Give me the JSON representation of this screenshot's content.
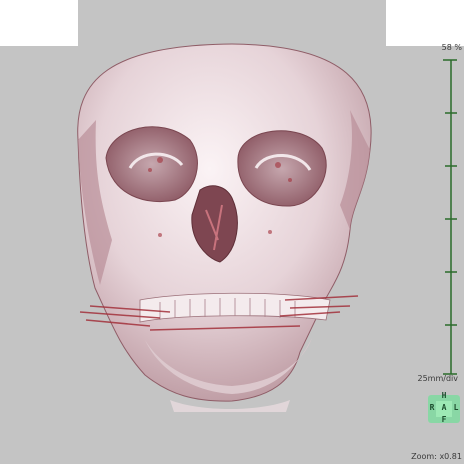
{
  "viewer": {
    "corner_value": "58 %",
    "scale_label": "25mm/div",
    "zoom_readout": "Zoom: x0.81",
    "orientation": {
      "top": "H",
      "left": "R",
      "center": "A",
      "right": "L",
      "bottom": "F"
    }
  },
  "colors": {
    "background": "#c4c4c4",
    "bone": "#ecdfe3",
    "ruler": "#2a6b2a",
    "orientation_cube": "#7fdba0",
    "tissue_red": "#a3313b"
  },
  "icons": [
    "ruler-icon",
    "orientation-cube-icon"
  ]
}
